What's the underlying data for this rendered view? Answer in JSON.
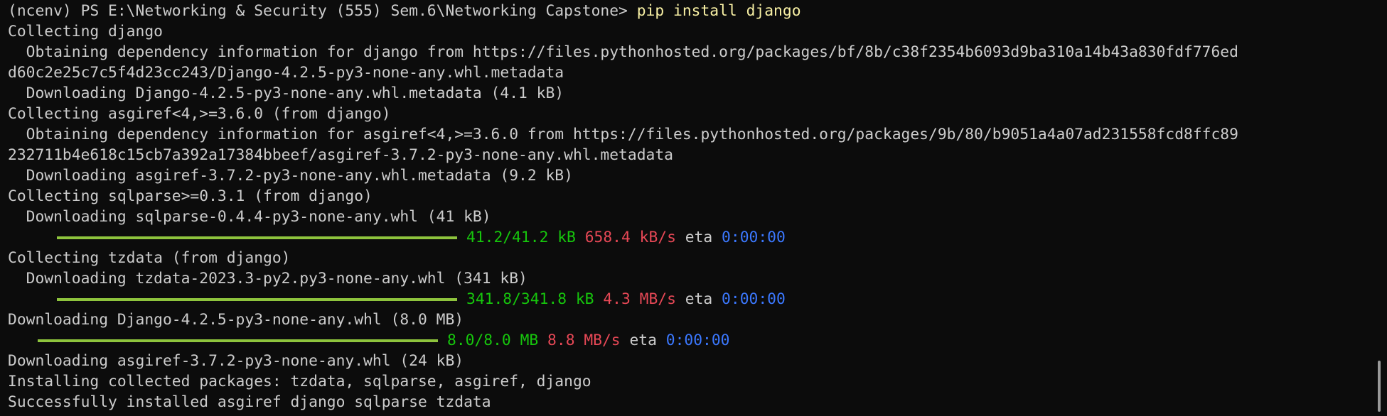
{
  "terminal": {
    "prompt": "(ncenv) PS E:\\Networking & Security (555) Sem.6\\Networking Capstone> ",
    "command": "pip install django",
    "lines": {
      "l2": "Collecting django",
      "l3": "  Obtaining dependency information for django from https://files.pythonhosted.org/packages/bf/8b/c38f2354b6093d9ba310a14b43a830fdf776ed",
      "l4": "d60c2e25c7c5f4d23cc243/Django-4.2.5-py3-none-any.whl.metadata",
      "l5": "  Downloading Django-4.2.5-py3-none-any.whl.metadata (4.1 kB)",
      "l6": "Collecting asgiref<4,>=3.6.0 (from django)",
      "l7": "  Obtaining dependency information for asgiref<4,>=3.6.0 from https://files.pythonhosted.org/packages/9b/80/b9051a4a07ad231558fcd8ffc89",
      "l8": "232711b4e618c15cb7a392a17384bbeef/asgiref-3.7.2-py3-none-any.whl.metadata",
      "l9": "  Downloading asgiref-3.7.2-py3-none-any.whl.metadata (9.2 kB)",
      "l10": "Collecting sqlparse>=0.3.1 (from django)",
      "l11": "  Downloading sqlparse-0.4.4-py3-none-any.whl (41 kB)",
      "l13": "Collecting tzdata (from django)",
      "l14": "  Downloading tzdata-2023.3-py2.py3-none-any.whl (341 kB)",
      "l16": "Downloading Django-4.2.5-py3-none-any.whl (8.0 MB)",
      "l18": "Downloading asgiref-3.7.2-py3-none-any.whl (24 kB)",
      "l19": "Installing collected packages: tzdata, sqlparse, asgiref, django",
      "l20": "Successfully installed asgiref django sqlparse tzdata"
    },
    "progress": [
      {
        "fraction": 1.0,
        "size": "41.2/41.2 kB",
        "speed": "658.4 kB/s",
        "eta_label": "eta",
        "eta": "0:00:00"
      },
      {
        "fraction": 1.0,
        "size": "341.8/341.8 kB",
        "speed": "4.3 MB/s",
        "eta_label": "eta",
        "eta": "0:00:00"
      },
      {
        "fraction": 1.0,
        "size": "8.0/8.0 MB",
        "speed": "8.8 MB/s",
        "eta_label": "eta",
        "eta": "0:00:00"
      }
    ],
    "colors": {
      "background": "#0c0c0c",
      "foreground": "#cccccc",
      "command": "#f9f1a5",
      "progress_bar": "#8ec43d",
      "size": "#16c60c",
      "speed": "#e74856",
      "eta": "#3b78ff"
    }
  }
}
